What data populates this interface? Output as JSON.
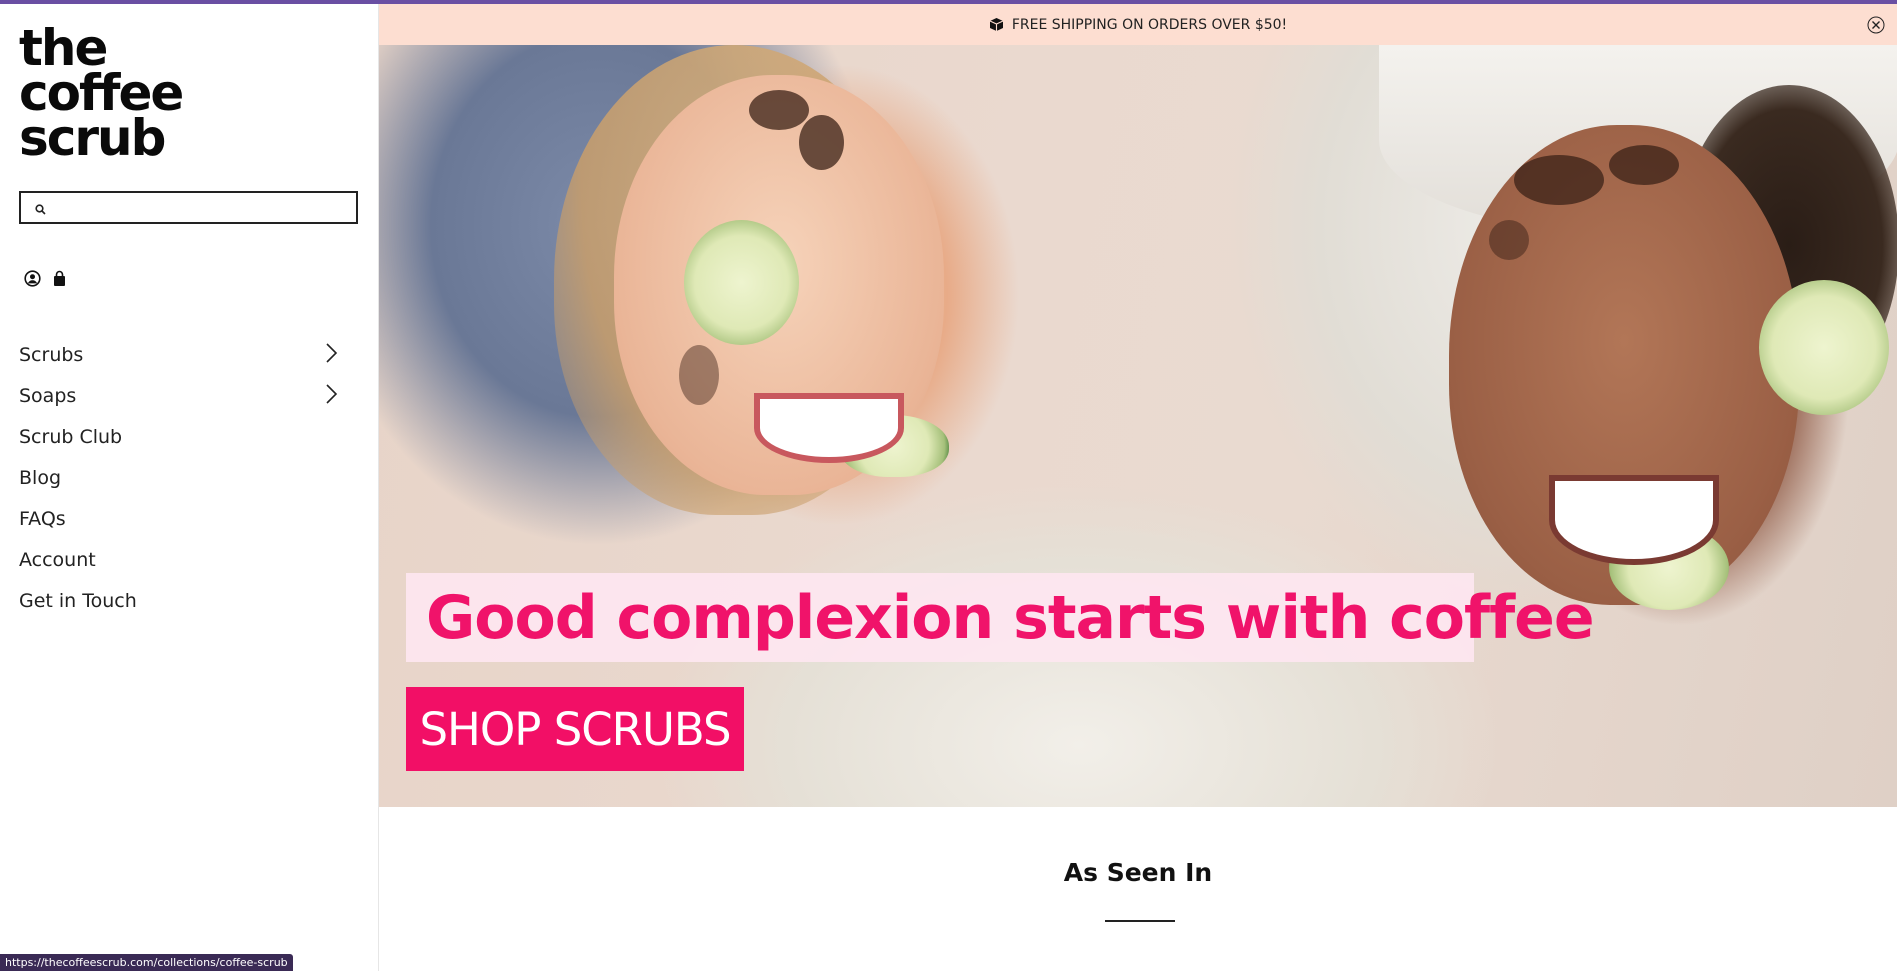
{
  "brand": {
    "logo_lines": [
      "the",
      "coffee",
      "scrub"
    ]
  },
  "search": {
    "placeholder": "",
    "value": ""
  },
  "header_icons": [
    "account-icon",
    "bag-icon"
  ],
  "nav": {
    "items": [
      {
        "label": "Scrubs",
        "has_submenu": true
      },
      {
        "label": "Soaps",
        "has_submenu": true
      },
      {
        "label": "Scrub Club",
        "has_submenu": false
      },
      {
        "label": "Blog",
        "has_submenu": false
      },
      {
        "label": "FAQs",
        "has_submenu": false
      },
      {
        "label": "Account",
        "has_submenu": false
      },
      {
        "label": "Get in Touch",
        "has_submenu": false
      }
    ]
  },
  "announcement": {
    "text": "FREE SHIPPING ON ORDERS OVER $50!",
    "icon": "box-icon",
    "close_icon": "close-icon"
  },
  "hero": {
    "headline": "Good complexion starts with coffee",
    "cta_label": "SHOP SCRUBS"
  },
  "section": {
    "title": "As Seen In"
  },
  "status_bar": {
    "url": "https://thecoffeescrub.com/collections/coffee-scrub"
  },
  "colors": {
    "accent_pink": "#f20f66",
    "banner_bg": "#fdded1",
    "top_line": "#6a4fa3"
  }
}
